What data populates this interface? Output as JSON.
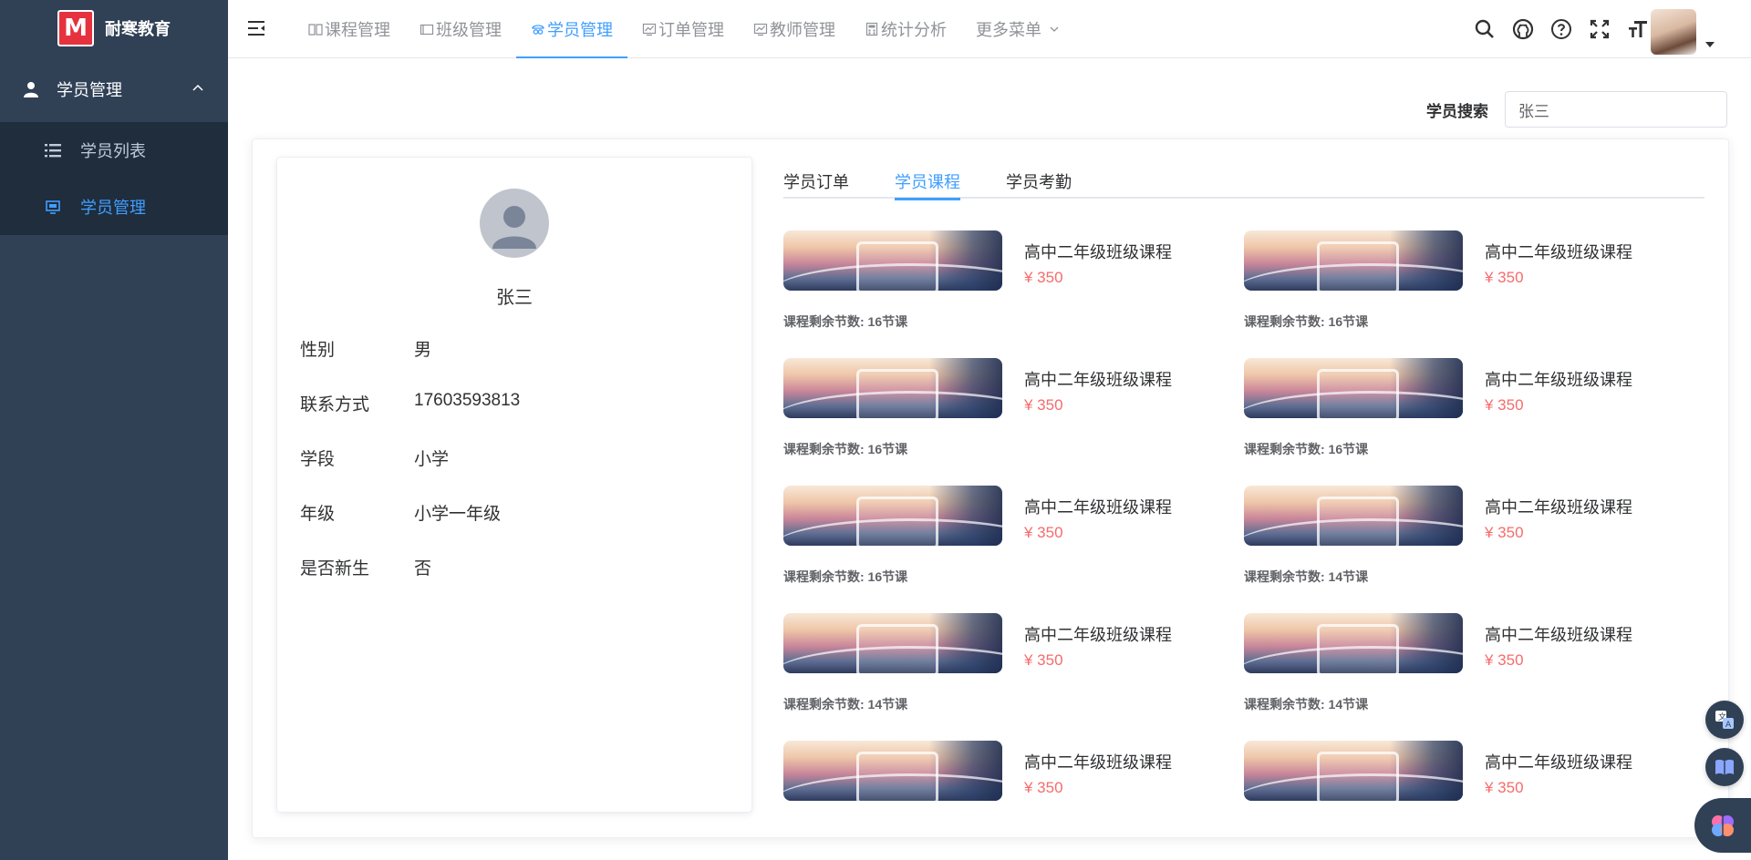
{
  "app": {
    "logo_letter": "M",
    "name": "耐寒教育"
  },
  "sidebar": {
    "group": {
      "label": "学员管理",
      "icon": "user-icon"
    },
    "items": [
      {
        "label": "学员列表",
        "icon": "list-icon",
        "active": false
      },
      {
        "label": "学员管理",
        "icon": "monitor-icon",
        "active": true
      }
    ]
  },
  "nav": {
    "tabs": [
      {
        "label": "课程管理",
        "icon": "book-icon",
        "active": false
      },
      {
        "label": "班级管理",
        "icon": "folder-icon",
        "active": false
      },
      {
        "label": "学员管理",
        "icon": "student-icon",
        "active": true
      },
      {
        "label": "订单管理",
        "icon": "chart-icon",
        "active": false
      },
      {
        "label": "教师管理",
        "icon": "chart-icon",
        "active": false
      },
      {
        "label": "统计分析",
        "icon": "calc-icon",
        "active": false
      },
      {
        "label": "更多菜单",
        "icon": "chevron-down-icon",
        "active": false
      }
    ],
    "tools": [
      "search-icon",
      "github-icon",
      "help-icon",
      "fullscreen-icon",
      "font-size-icon"
    ]
  },
  "search": {
    "label": "学员搜索",
    "value": "张三"
  },
  "profile": {
    "name": "张三",
    "fields": [
      {
        "key": "性别",
        "value": "男"
      },
      {
        "key": "联系方式",
        "value": "17603593813"
      },
      {
        "key": "学段",
        "value": "小学"
      },
      {
        "key": "年级",
        "value": "小学一年级"
      },
      {
        "key": "是否新生",
        "value": "否"
      }
    ]
  },
  "tabs": [
    {
      "label": "学员订单",
      "active": false
    },
    {
      "label": "学员课程",
      "active": true
    },
    {
      "label": "学员考勤",
      "active": false
    }
  ],
  "courses": [
    {
      "title": "高中二年级班级课程",
      "price": "¥ 350",
      "remaining": "课程剩余节数: 16节课"
    },
    {
      "title": "高中二年级班级课程",
      "price": "¥ 350",
      "remaining": "课程剩余节数: 16节课"
    },
    {
      "title": "高中二年级班级课程",
      "price": "¥ 350",
      "remaining": "课程剩余节数: 16节课"
    },
    {
      "title": "高中二年级班级课程",
      "price": "¥ 350",
      "remaining": "课程剩余节数: 16节课"
    },
    {
      "title": "高中二年级班级课程",
      "price": "¥ 350",
      "remaining": "课程剩余节数: 16节课"
    },
    {
      "title": "高中二年级班级课程",
      "price": "¥ 350",
      "remaining": "课程剩余节数: 14节课"
    },
    {
      "title": "高中二年级班级课程",
      "price": "¥ 350",
      "remaining": "课程剩余节数: 14节课"
    },
    {
      "title": "高中二年级班级课程",
      "price": "¥ 350",
      "remaining": "课程剩余节数: 14节课"
    },
    {
      "title": "高中二年级班级课程",
      "price": "¥ 350",
      "remaining": ""
    },
    {
      "title": "高中二年级班级课程",
      "price": "¥ 350",
      "remaining": ""
    }
  ],
  "floating": [
    "translate-icon",
    "book-open-icon",
    "brain-icon"
  ],
  "colors": {
    "sidebar": "#304156",
    "submenu": "#1f2d3d",
    "accent": "#409eff",
    "price": "#f56c6c"
  }
}
